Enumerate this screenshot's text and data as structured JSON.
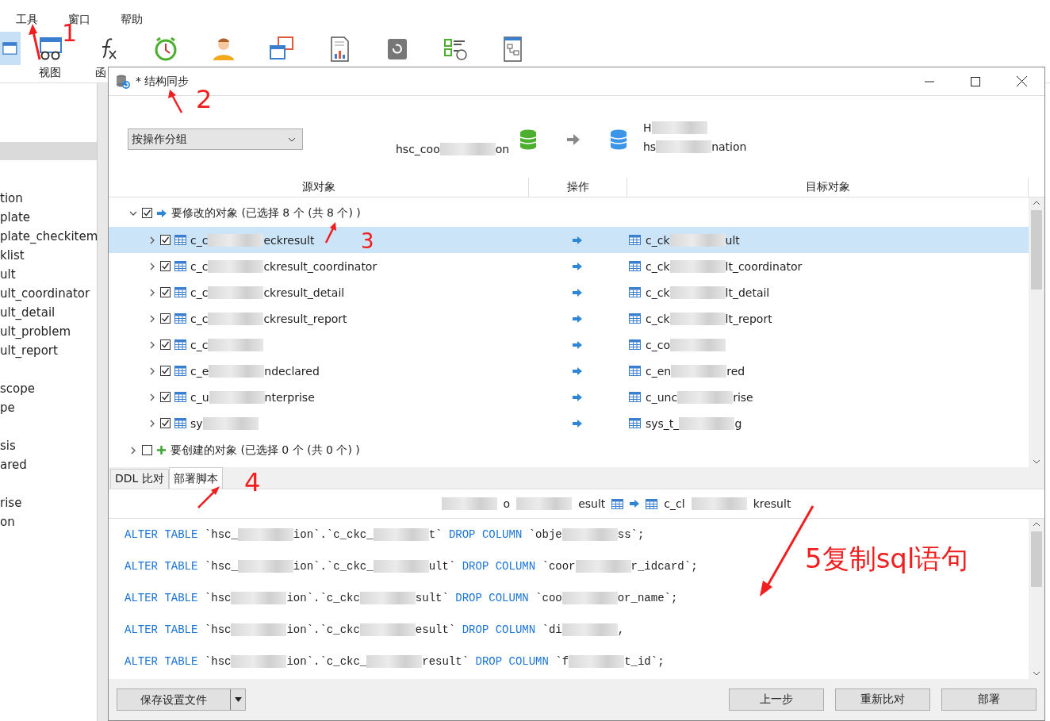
{
  "menu": [
    {
      "label": "工具"
    },
    {
      "label": "窗口"
    },
    {
      "label": "帮助"
    }
  ],
  "toolbar": [
    {
      "selected": true
    },
    {
      "label": "视图",
      "selected": false
    },
    {
      "label": "函",
      "selected": false
    },
    {
      "selected": false
    },
    {
      "selected": false
    },
    {
      "selected": false
    },
    {
      "selected": false
    },
    {
      "selected": false
    },
    {
      "selected": false
    },
    {
      "selected": false
    }
  ],
  "sidebar": {
    "highlighted_row": true,
    "groups": [
      [
        "tion",
        "plate",
        "plate_checkitem",
        "klist",
        "ult",
        "ult_coordinator",
        "ult_detail",
        "ult_problem",
        "ult_report"
      ],
      [
        "scope",
        "pe"
      ],
      [
        "sis",
        "ared"
      ],
      [
        "rise",
        "on"
      ]
    ]
  },
  "dialog": {
    "title": "* 结构同步",
    "group_by": {
      "value": "按操作分组"
    },
    "source": [
      {
        "kind": "text",
        "text": "hsc_coo"
      },
      {
        "kind": "blur"
      },
      {
        "kind": "text",
        "text": "on"
      }
    ],
    "target": [
      [
        {
          "kind": "text",
          "text": "H"
        },
        {
          "kind": "blur"
        }
      ],
      [
        {
          "kind": "text",
          "text": "hs"
        },
        {
          "kind": "blur"
        },
        {
          "kind": "text",
          "text": "nation"
        }
      ]
    ],
    "columns": [
      "源对象",
      "操作",
      "目标对象"
    ],
    "groups": [
      {
        "kind": "modify",
        "label": "要修改的对象 (已选择 8 个 (共 8 个) )",
        "expanded": true,
        "checked": true,
        "rows": [
          {
            "selected": true,
            "checked": true,
            "source": [
              {
                "kind": "text",
                "text": "c_c"
              },
              {
                "kind": "blur"
              },
              {
                "kind": "text",
                "text": "eckresult"
              }
            ],
            "target": [
              {
                "kind": "text",
                "text": "c_ck"
              },
              {
                "kind": "blur"
              },
              {
                "kind": "text",
                "text": "ult"
              }
            ]
          },
          {
            "selected": false,
            "checked": true,
            "source": [
              {
                "kind": "text",
                "text": "c_c"
              },
              {
                "kind": "blur"
              },
              {
                "kind": "text",
                "text": "ckresult_coordinator"
              }
            ],
            "target": [
              {
                "kind": "text",
                "text": "c_ck"
              },
              {
                "kind": "blur"
              },
              {
                "kind": "text",
                "text": "lt_coordinator"
              }
            ]
          },
          {
            "selected": false,
            "checked": true,
            "source": [
              {
                "kind": "text",
                "text": "c_c"
              },
              {
                "kind": "blur"
              },
              {
                "kind": "text",
                "text": "ckresult_detail"
              }
            ],
            "target": [
              {
                "kind": "text",
                "text": "c_ck"
              },
              {
                "kind": "blur"
              },
              {
                "kind": "text",
                "text": "lt_detail"
              }
            ]
          },
          {
            "selected": false,
            "checked": true,
            "source": [
              {
                "kind": "text",
                "text": "c_c"
              },
              {
                "kind": "blur"
              },
              {
                "kind": "text",
                "text": "ckresult_report"
              }
            ],
            "target": [
              {
                "kind": "text",
                "text": "c_ck"
              },
              {
                "kind": "blur"
              },
              {
                "kind": "text",
                "text": "lt_report"
              }
            ]
          },
          {
            "selected": false,
            "checked": true,
            "source": [
              {
                "kind": "text",
                "text": "c_c"
              },
              {
                "kind": "blur"
              }
            ],
            "target": [
              {
                "kind": "text",
                "text": "c_co"
              },
              {
                "kind": "blur"
              }
            ]
          },
          {
            "selected": false,
            "checked": true,
            "source": [
              {
                "kind": "text",
                "text": "c_e"
              },
              {
                "kind": "blur"
              },
              {
                "kind": "text",
                "text": "ndeclared"
              }
            ],
            "target": [
              {
                "kind": "text",
                "text": "c_en"
              },
              {
                "kind": "blur"
              },
              {
                "kind": "text",
                "text": "red"
              }
            ]
          },
          {
            "selected": false,
            "checked": true,
            "source": [
              {
                "kind": "text",
                "text": "c_u"
              },
              {
                "kind": "blur"
              },
              {
                "kind": "text",
                "text": "nterprise"
              }
            ],
            "target": [
              {
                "kind": "text",
                "text": "c_unc"
              },
              {
                "kind": "blur"
              },
              {
                "kind": "text",
                "text": "rise"
              }
            ]
          },
          {
            "selected": false,
            "checked": true,
            "source": [
              {
                "kind": "text",
                "text": "sy"
              },
              {
                "kind": "blur"
              }
            ],
            "target": [
              {
                "kind": "text",
                "text": "sys_t_"
              },
              {
                "kind": "blur"
              },
              {
                "kind": "text",
                "text": "g"
              }
            ]
          }
        ]
      },
      {
        "kind": "create",
        "label": "要创建的对象 (已选择 0 个 (共 0 个) )",
        "expanded": false,
        "checked": false
      }
    ],
    "tabs": [
      {
        "label": "DDL 比对",
        "selected": false
      },
      {
        "label": "部署脚本",
        "selected": true
      }
    ],
    "script_header": {
      "source": [
        {
          "kind": "blur"
        },
        {
          "kind": "text",
          "text": "o"
        },
        {
          "kind": "blur"
        },
        {
          "kind": "text",
          "text": "esult"
        }
      ],
      "target": [
        {
          "kind": "text",
          "text": "c_cl"
        },
        {
          "kind": "blur"
        },
        {
          "kind": "text",
          "text": "kresult"
        }
      ]
    },
    "script_lines": [
      [
        {
          "kind": "kw",
          "text": "ALTER TABLE"
        },
        {
          "kind": "text",
          "text": " `hsc_"
        },
        {
          "kind": "blur"
        },
        {
          "kind": "text",
          "text": "ion`.`c_ckc_"
        },
        {
          "kind": "blur"
        },
        {
          "kind": "text",
          "text": "t` "
        },
        {
          "kind": "kw",
          "text": "DROP COLUMN"
        },
        {
          "kind": "text",
          "text": " `obje"
        },
        {
          "kind": "blur"
        },
        {
          "kind": "text",
          "text": "ss`;"
        }
      ],
      [
        {
          "kind": "kw",
          "text": "ALTER TABLE"
        },
        {
          "kind": "text",
          "text": " `hsc_"
        },
        {
          "kind": "blur"
        },
        {
          "kind": "text",
          "text": "ion`.`c_ckc_"
        },
        {
          "kind": "blur"
        },
        {
          "kind": "text",
          "text": "ult` "
        },
        {
          "kind": "kw",
          "text": "DROP COLUMN"
        },
        {
          "kind": "text",
          "text": " `coor"
        },
        {
          "kind": "blur"
        },
        {
          "kind": "text",
          "text": "r_idcard`;"
        }
      ],
      [
        {
          "kind": "kw",
          "text": "ALTER TABLE"
        },
        {
          "kind": "text",
          "text": " `hsc"
        },
        {
          "kind": "blur"
        },
        {
          "kind": "text",
          "text": "ion`.`c_ckc"
        },
        {
          "kind": "blur"
        },
        {
          "kind": "text",
          "text": "sult` "
        },
        {
          "kind": "kw",
          "text": "DROP COLUMN"
        },
        {
          "kind": "text",
          "text": " `coo"
        },
        {
          "kind": "blur"
        },
        {
          "kind": "text",
          "text": "or_name`;"
        }
      ],
      [
        {
          "kind": "kw",
          "text": "ALTER TABLE"
        },
        {
          "kind": "text",
          "text": " `hsc"
        },
        {
          "kind": "blur"
        },
        {
          "kind": "text",
          "text": "ion`.`c_ckc"
        },
        {
          "kind": "blur"
        },
        {
          "kind": "text",
          "text": "esult` "
        },
        {
          "kind": "kw",
          "text": "DROP COLUMN"
        },
        {
          "kind": "text",
          "text": " `di"
        },
        {
          "kind": "blur"
        },
        {
          "kind": "text",
          "text": ","
        }
      ],
      [
        {
          "kind": "kw",
          "text": "ALTER TABLE"
        },
        {
          "kind": "text",
          "text": " `hsc"
        },
        {
          "kind": "blur"
        },
        {
          "kind": "text",
          "text": "ion`.`c_ckc_"
        },
        {
          "kind": "blur"
        },
        {
          "kind": "text",
          "text": "result` "
        },
        {
          "kind": "kw",
          "text": "DROP COLUMN"
        },
        {
          "kind": "text",
          "text": " `f"
        },
        {
          "kind": "blur"
        },
        {
          "kind": "text",
          "text": "t_id`;"
        }
      ]
    ],
    "footer": {
      "save": {
        "label": "保存设置文件"
      },
      "buttons": [
        "上一步",
        "重新比对",
        "部署"
      ]
    }
  },
  "annotations": [
    "1",
    "2",
    "3",
    "4",
    "5复制sql语句"
  ]
}
